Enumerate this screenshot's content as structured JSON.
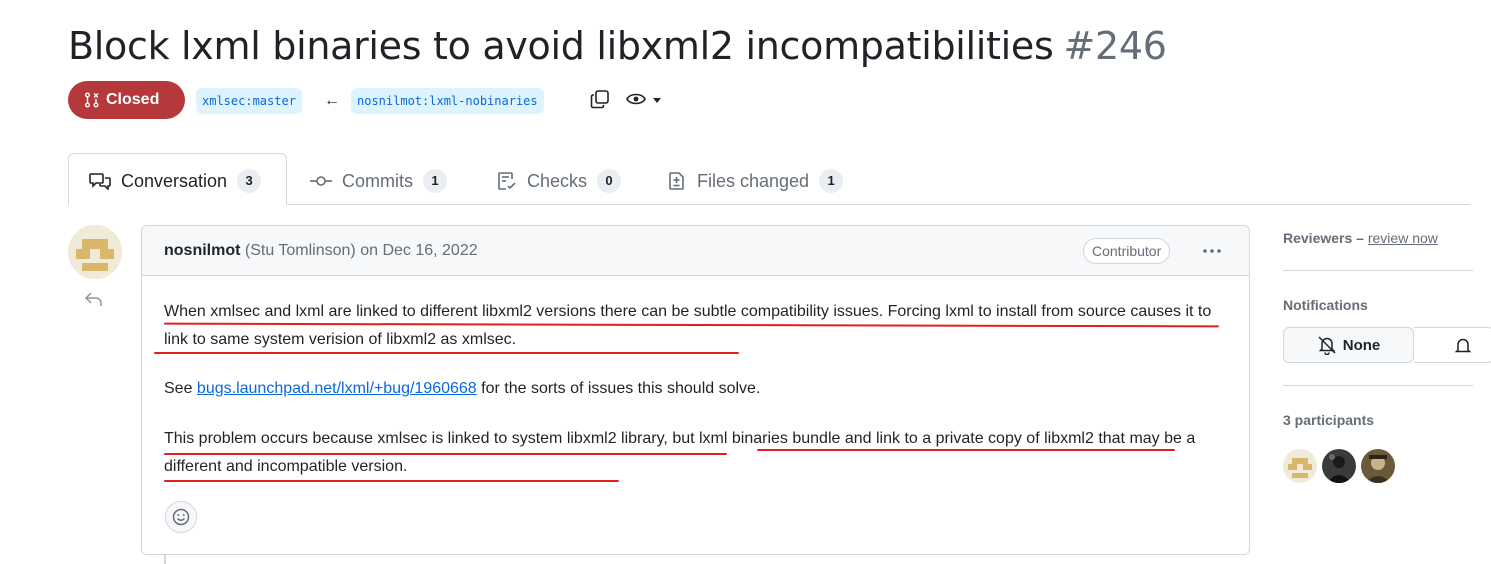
{
  "pr": {
    "title": "Block lxml binaries to avoid libxml2 incompatibilities",
    "number": "#246",
    "state": "Closed",
    "base_branch": "xmlsec:master",
    "arrow": "←",
    "head_branch": "nosnilmot:lxml-nobinaries"
  },
  "tabs": [
    {
      "label": "Conversation",
      "count": "3",
      "icon": "comment-discussion-icon"
    },
    {
      "label": "Commits",
      "count": "1",
      "icon": "git-commit-icon"
    },
    {
      "label": "Checks",
      "count": "0",
      "icon": "checklist-icon"
    },
    {
      "label": "Files changed",
      "count": "1",
      "icon": "file-diff-icon"
    }
  ],
  "comment": {
    "author": "nosnilmot",
    "author_name": "(Stu Tomlinson)",
    "date": "on Dec 16, 2022",
    "role": "Contributor",
    "para1": "When xmlsec and lxml are linked to different libxml2 versions there can be subtle compatibility issues. Forcing lxml to install from source causes it to link to same system verision of libxml2 as xmlsec.",
    "para2_before": "See ",
    "para2_link": "bugs.launchpad.net/lxml/+bug/1960668",
    "para2_after": " for the sorts of issues this should solve.",
    "para3": "This problem occurs because xmlsec is linked to system libxml2 library, but lxml binaries bundle and link to a private copy of libxml2 that may be a different and incompatible version."
  },
  "sidebar": {
    "reviewers_label": "Reviewers –",
    "review_now": "review now",
    "notifications_label": "Notifications",
    "notifications_button": "None",
    "participants_label": "3 participants"
  },
  "colors": {
    "closed": "#b5383a",
    "branch_bg": "#ddf4ff",
    "link": "#0969da",
    "annotation": "#e0201c"
  }
}
